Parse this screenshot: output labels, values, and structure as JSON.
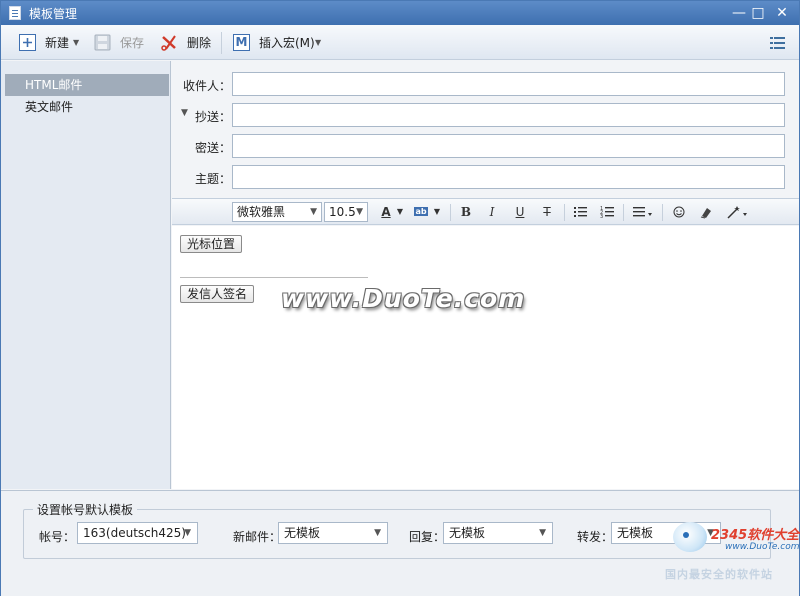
{
  "window": {
    "title": "模板管理",
    "minimize": "—",
    "maximize": "□",
    "close": "✕"
  },
  "toolbar": {
    "new_label": "新建",
    "save_label": "保存",
    "delete_label": "删除",
    "insert_macro_label": "插入宏(M)",
    "insert_macro_icon_text": "M",
    "menu_icon": "menu-icon"
  },
  "sidebar": {
    "items": [
      {
        "label": "HTML邮件",
        "selected": true
      },
      {
        "label": "英文邮件",
        "selected": false
      }
    ]
  },
  "form": {
    "to_label": "收件人：",
    "cc_label": "抄送：",
    "bcc_label": "密送：",
    "subject_label": "主题：",
    "to_value": "",
    "cc_value": "",
    "bcc_value": "",
    "subject_value": ""
  },
  "format_bar": {
    "font": "微软雅黑",
    "size": "10.5",
    "font_color_glyph": "A",
    "highlight_glyph": "ab",
    "bold": "B",
    "italic": "I",
    "underline": "U",
    "strike": "T"
  },
  "editor": {
    "cursor_button": "光标位置",
    "signature_button": "发信人签名"
  },
  "watermark": "www.DuoTe.com",
  "bottom": {
    "group_title": "设置帐号默认模板",
    "account_label": "帐号：",
    "account_value": "163(deutsch425)",
    "new_mail_label": "新邮件：",
    "new_mail_value": "无模板",
    "reply_label": "回复：",
    "reply_value": "无模板",
    "forward_label": "转发：",
    "forward_value": "无模板"
  },
  "logo": {
    "brand": "2345软件大全",
    "site": "www.DuoTe.com",
    "footer": "国内最安全的软件站"
  },
  "colors": {
    "titlebar": "#4a79b4",
    "selected_item": "#a0acba",
    "delete_red": "#d03a2a"
  }
}
